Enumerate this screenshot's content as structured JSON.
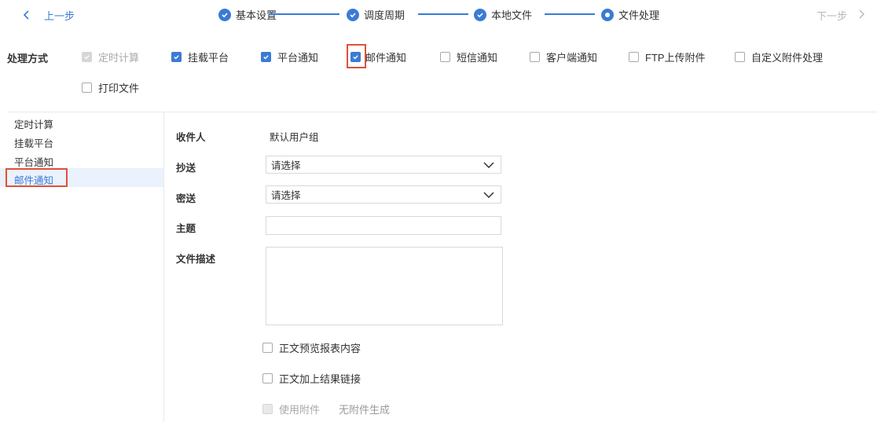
{
  "topbar": {
    "prev_label": "上一步",
    "next_label": "下一步",
    "steps": [
      {
        "label": "基本设置",
        "state": "done"
      },
      {
        "label": "调度周期",
        "state": "done"
      },
      {
        "label": "本地文件",
        "state": "done"
      },
      {
        "label": "文件处理",
        "state": "current"
      }
    ]
  },
  "methods": {
    "title": "处理方式",
    "options": [
      {
        "label": "定时计算",
        "checked": true,
        "disabled": true
      },
      {
        "label": "挂载平台",
        "checked": true,
        "disabled": false
      },
      {
        "label": "平台通知",
        "checked": true,
        "disabled": false
      },
      {
        "label": "邮件通知",
        "checked": true,
        "disabled": false,
        "highlighted": true
      },
      {
        "label": "短信通知",
        "checked": false,
        "disabled": false
      },
      {
        "label": "客户端通知",
        "checked": false,
        "disabled": false
      },
      {
        "label": "FTP上传附件",
        "checked": false,
        "disabled": false
      },
      {
        "label": "自定义附件处理",
        "checked": false,
        "disabled": false
      },
      {
        "label": "打印文件",
        "checked": false,
        "disabled": false
      }
    ]
  },
  "sidenav": {
    "items": [
      "定时计算",
      "挂载平台",
      "平台通知",
      "邮件通知"
    ],
    "active": "邮件通知"
  },
  "form": {
    "recipient_label": "收件人",
    "recipient_value": "默认用户组",
    "cc_label": "抄送",
    "cc_value": "请选择",
    "bcc_label": "密送",
    "bcc_value": "请选择",
    "subject_label": "主题",
    "subject_value": "",
    "desc_label": "文件描述",
    "desc_value": "",
    "preview_label": "正文预览报表内容",
    "link_label": "正文加上结果链接",
    "attach_label": "使用附件",
    "attach_note": "无附件生成"
  },
  "colors": {
    "accent": "#3a7bd5",
    "highlight": "#e0503a",
    "active_bg": "#eaf2fd"
  }
}
